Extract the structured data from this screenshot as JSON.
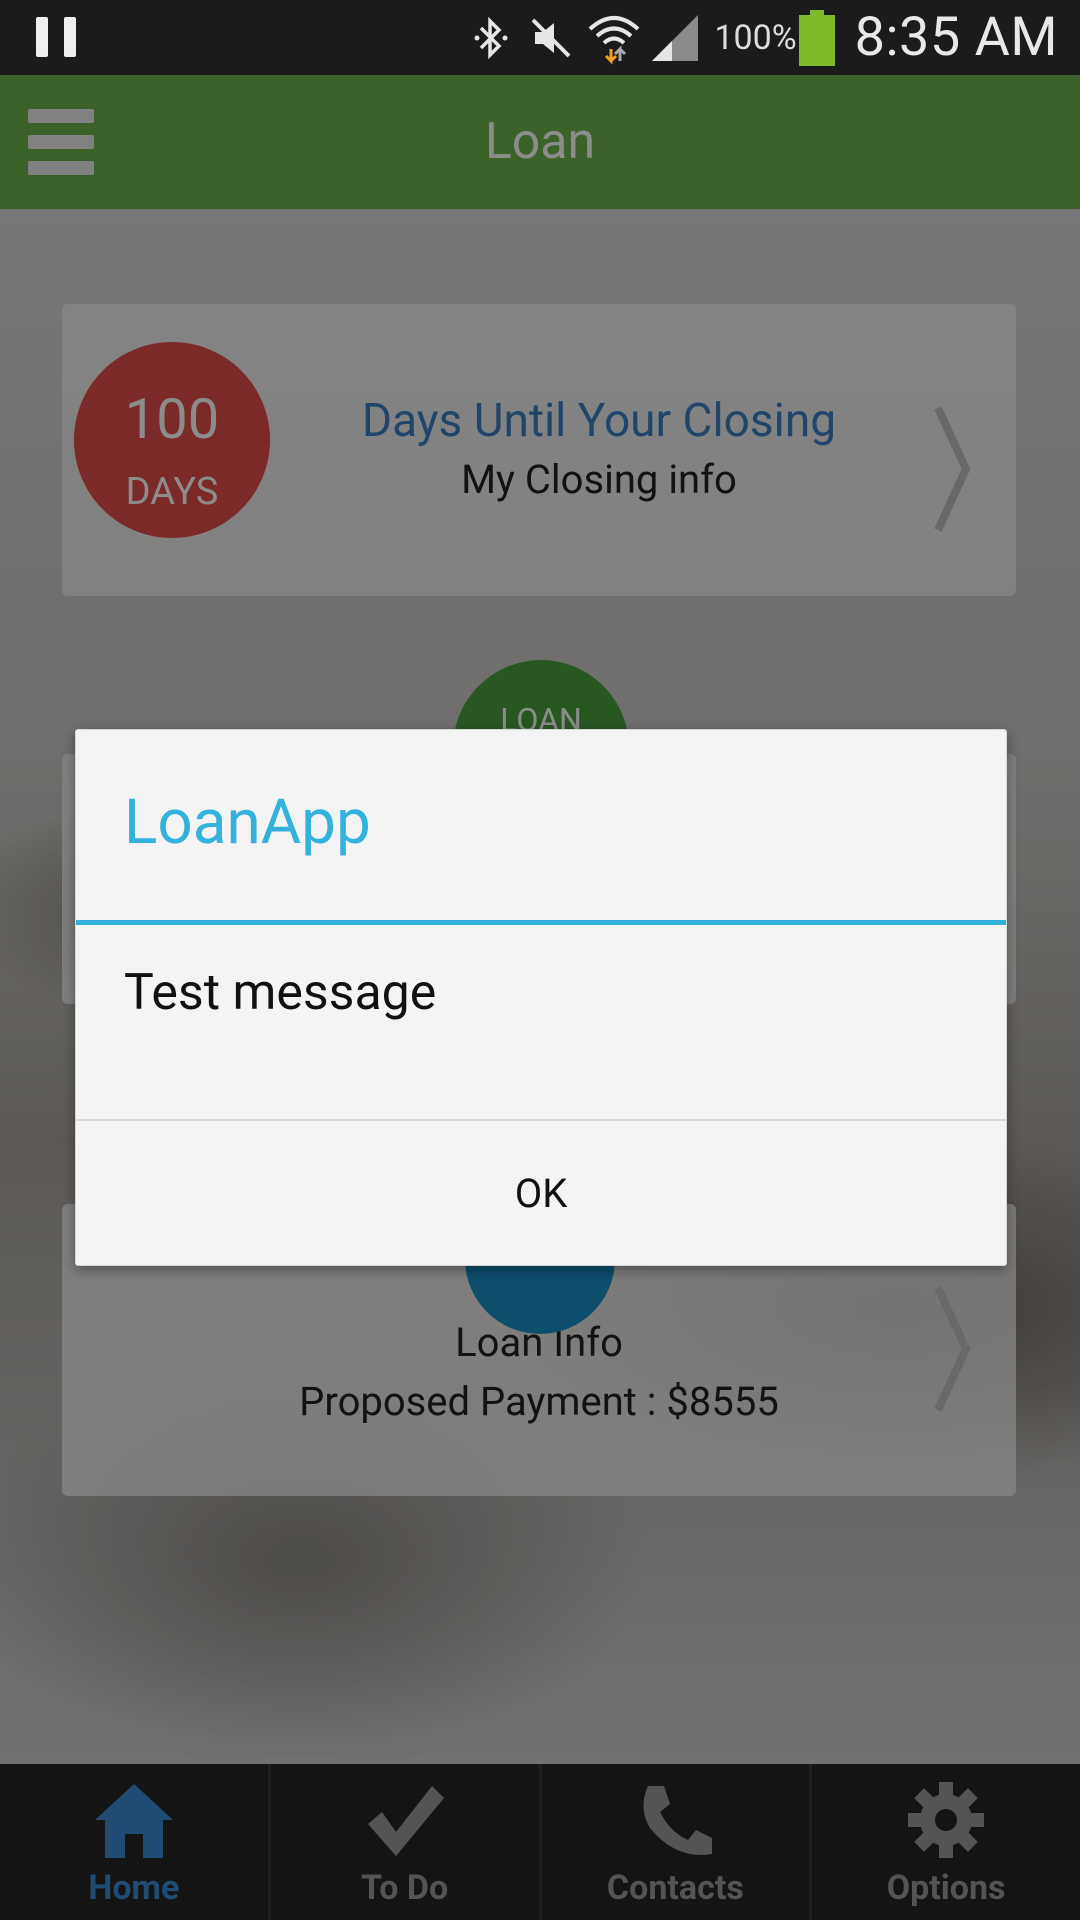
{
  "status_bar": {
    "battery_percent": "100%",
    "time": "8:35 AM",
    "icons": [
      "pause-icon",
      "bluetooth-icon",
      "mute-icon",
      "wifi-icon",
      "signal-icon",
      "battery-icon"
    ]
  },
  "app_bar": {
    "title": "Loan",
    "menu_icon": "hamburger-menu-icon"
  },
  "closing_card": {
    "days_value": "100",
    "days_unit": "DAYS",
    "headline": "Days Until Your Closing",
    "subtitle": "My Closing info"
  },
  "middle_card": {
    "circle_label": "LOAN"
  },
  "loan_card": {
    "title": "Loan Info",
    "payment": "Proposed Payment : $8555"
  },
  "bottom_nav": {
    "items": [
      {
        "label": "Home",
        "icon": "home-icon",
        "active": true
      },
      {
        "label": "To Do",
        "icon": "checkmark-icon",
        "active": false
      },
      {
        "label": "Contacts",
        "icon": "phone-icon",
        "active": false
      },
      {
        "label": "Options",
        "icon": "gear-icon",
        "active": false
      }
    ]
  },
  "dialog": {
    "title": "LoanApp",
    "message": "Test message",
    "ok_label": "OK"
  },
  "colors": {
    "app_bar": "#6fb24c",
    "dialog_accent": "#33b2de",
    "days_circle": "#e04b4b",
    "nav_active": "#3b8ad4"
  }
}
